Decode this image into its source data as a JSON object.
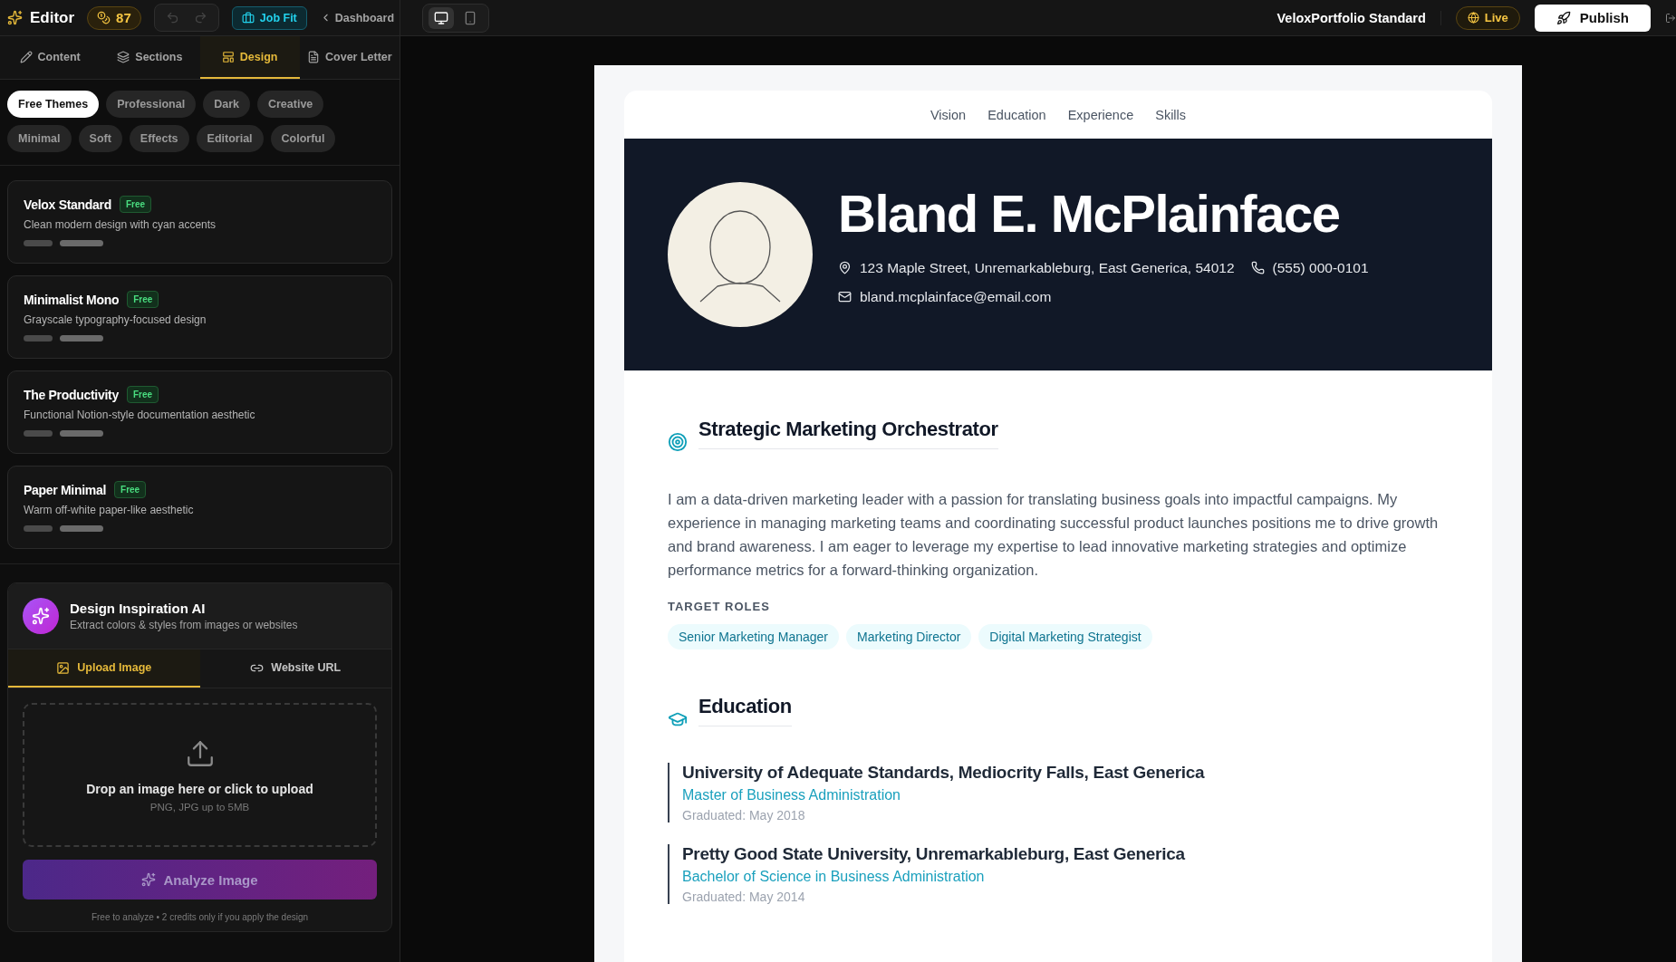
{
  "topbar": {
    "app_title": "Editor",
    "credits": "87",
    "history": {
      "undo_disabled": true,
      "redo_disabled": true
    },
    "job_fit": "Job Fit",
    "back_link": "Dashboard",
    "devices": [
      {
        "kind": "desktop",
        "selected": true
      },
      {
        "kind": "mobile",
        "selected": false
      }
    ],
    "document_title": "VeloxPortfolio Standard",
    "status": "Live",
    "publish": "Publish"
  },
  "editor_tabs": [
    {
      "label": "Content",
      "selected": false
    },
    {
      "label": "Sections",
      "selected": false
    },
    {
      "label": "Design",
      "selected": true
    },
    {
      "label": "Cover Letter",
      "selected": false
    }
  ],
  "theme_filters": [
    {
      "label": "Free Themes",
      "selected": true
    },
    {
      "label": "Professional",
      "selected": false
    },
    {
      "label": "Dark",
      "selected": false
    },
    {
      "label": "Creative",
      "selected": false
    },
    {
      "label": "Minimal",
      "selected": false
    },
    {
      "label": "Soft",
      "selected": false
    },
    {
      "label": "Effects",
      "selected": false
    },
    {
      "label": "Editorial",
      "selected": false
    },
    {
      "label": "Colorful",
      "selected": false
    }
  ],
  "themes": [
    {
      "name": "Velox Standard",
      "badge": "Free",
      "description": "Clean modern design with cyan accents"
    },
    {
      "name": "Minimalist Mono",
      "badge": "Free",
      "description": "Grayscale typography-focused design"
    },
    {
      "name": "The Productivity",
      "badge": "Free",
      "description": "Functional Notion-style documentation aesthetic"
    },
    {
      "name": "Paper Minimal",
      "badge": "Free",
      "description": "Warm off-white paper-like aesthetic"
    }
  ],
  "inspiration": {
    "title": "Design Inspiration AI",
    "subtitle": "Extract colors & styles from images or websites",
    "tabs": [
      {
        "label": "Upload Image",
        "selected": true
      },
      {
        "label": "Website URL",
        "selected": false
      }
    ],
    "dropzone": {
      "title": "Drop an image here or click to upload",
      "hint": "PNG, JPG up to 5MB"
    },
    "button": "Analyze Image",
    "footnote": "Free to analyze • 2 credits only if you apply the design"
  },
  "resume": {
    "nav": [
      "Vision",
      "Education",
      "Experience",
      "Skills"
    ],
    "name": "Bland E. McPlainface",
    "address": "123 Maple Street, Unremarkableburg, East Generica, 54012",
    "phone": "(555) 000-0101",
    "email": "bland.mcplainface@email.com",
    "summary": {
      "heading": "Strategic Marketing Orchestrator",
      "text": "I am a data-driven marketing leader with a passion for translating business goals into impactful campaigns. My experience in managing marketing teams and coordinating successful product launches positions me to drive growth and brand awareness. I am eager to leverage my expertise to lead innovative marketing strategies and optimize performance metrics for a forward-thinking organization.",
      "roles_label": "TARGET ROLES",
      "roles": [
        "Senior Marketing Manager",
        "Marketing Director",
        "Digital Marketing Strategist"
      ]
    },
    "education": {
      "heading": "Education",
      "entries": [
        {
          "school": "University of Adequate Standards, Mediocrity Falls, East Generica",
          "degree": "Master of Business Administration",
          "date": "Graduated: May 2018"
        },
        {
          "school": "Pretty Good State University, Unremarkableburg, East Generica",
          "degree": "Bachelor of Science in Business Administration",
          "date": "Graduated: May 2014"
        }
      ]
    }
  }
}
